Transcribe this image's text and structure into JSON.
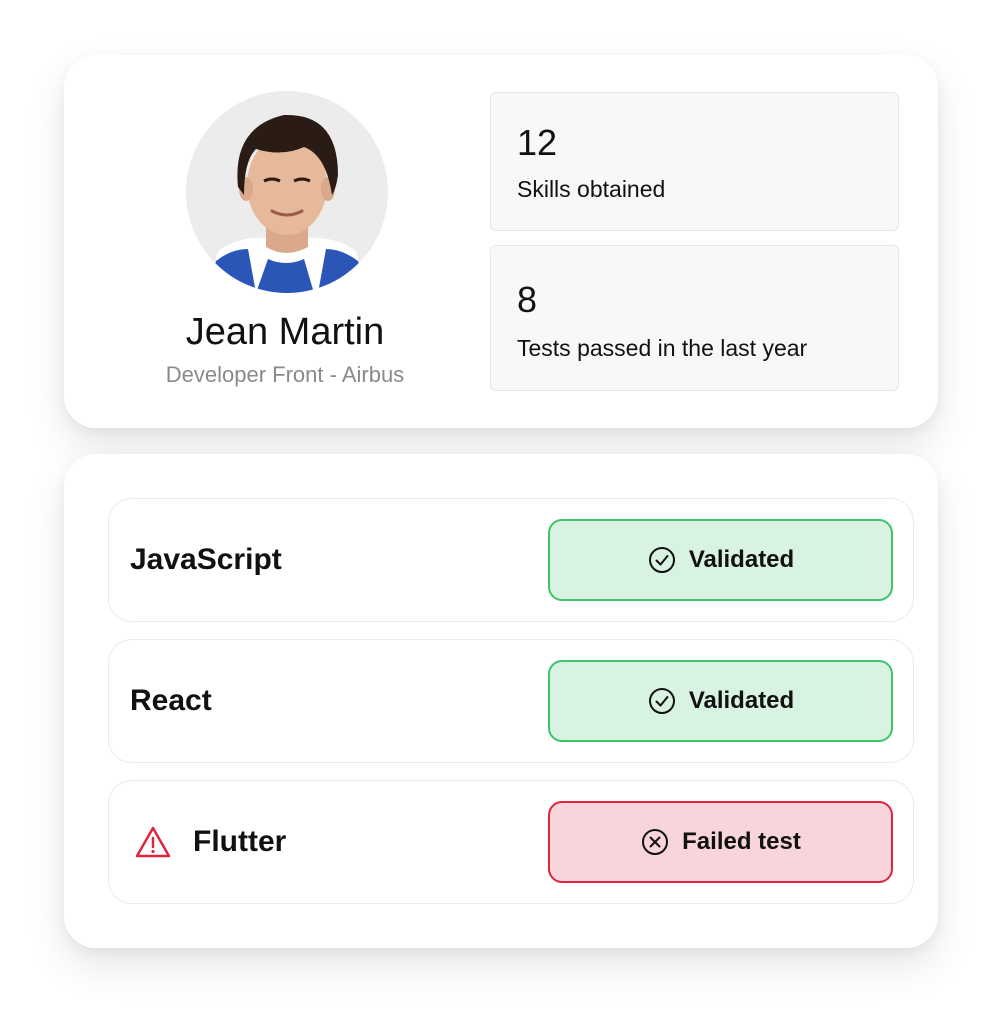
{
  "profile": {
    "name": "Jean Martin",
    "role": "Developer Front - Airbus",
    "stats": [
      {
        "value": "12",
        "label": "Skills obtained"
      },
      {
        "value": "8",
        "label": "Tests passed in the last year"
      }
    ]
  },
  "skills": [
    {
      "name": "JavaScript",
      "status": "Validated",
      "status_type": "success",
      "icon": "check-circle-icon"
    },
    {
      "name": "React",
      "status": "Validated",
      "status_type": "success",
      "icon": "check-circle-icon"
    },
    {
      "name": "Flutter",
      "status": "Failed test",
      "status_type": "failure",
      "icon": "x-circle-icon",
      "warning_icon": "warning-triangle-icon"
    }
  ],
  "colors": {
    "success_bg": "#d8f3e1",
    "success_border": "#3fc46b",
    "failure_bg": "#f8d5da",
    "failure_border": "#e0253f",
    "warning": "#e0253f",
    "muted_text": "#8a8a8a"
  }
}
